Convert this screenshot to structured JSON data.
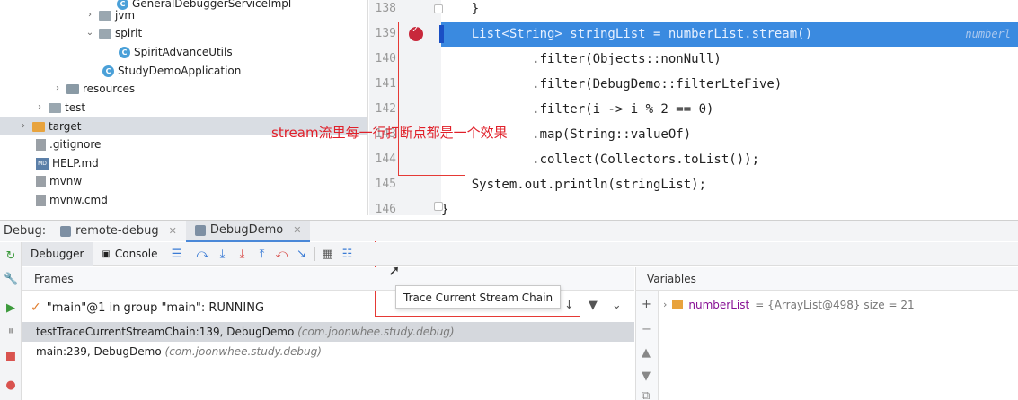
{
  "tree": {
    "items": [
      {
        "label": "GeneralDebuggerServiceImpl",
        "icon": "class-icon"
      },
      {
        "label": "jvm",
        "icon": "folder-icon"
      },
      {
        "label": "spirit",
        "icon": "folder-icon"
      },
      {
        "label": "SpiritAdvanceUtils",
        "icon": "class-icon"
      },
      {
        "label": "StudyDemoApplication",
        "icon": "class-icon"
      },
      {
        "label": "resources",
        "icon": "folder-icon"
      },
      {
        "label": "test",
        "icon": "folder-icon"
      },
      {
        "label": "target",
        "icon": "folder-icon"
      },
      {
        "label": ".gitignore",
        "icon": "file-icon"
      },
      {
        "label": "HELP.md",
        "icon": "markdown-icon"
      },
      {
        "label": "mvnw",
        "icon": "file-icon"
      },
      {
        "label": "mvnw.cmd",
        "icon": "file-icon"
      }
    ]
  },
  "editor": {
    "lines": [
      {
        "num": "138",
        "text": "    }"
      },
      {
        "num": "139",
        "text": "    List<String> stringList = numberList.stream()",
        "hint": "numberl"
      },
      {
        "num": "140",
        "text": "            .filter(Objects::nonNull)"
      },
      {
        "num": "141",
        "text": "            .filter(DebugDemo::filterLteFive)"
      },
      {
        "num": "142",
        "text": "            .filter(i -> i % 2 == 0)"
      },
      {
        "num": "143",
        "text": "            .map(String::valueOf)"
      },
      {
        "num": "144",
        "text": "            .collect(Collectors.toList());"
      },
      {
        "num": "145",
        "text": "    System.out.println(stringList);"
      },
      {
        "num": "146",
        "text": "}"
      }
    ]
  },
  "annotation": "stream流里每一行打断点都是一个效果",
  "debug": {
    "label": "Debug:",
    "tabs": [
      "remote-debug",
      "DebugDemo"
    ],
    "toolbar_tabs": [
      "Debugger",
      "Console"
    ],
    "frames_header": "Frames",
    "variables_header": "Variables",
    "thread": "\"main\"@1 in group \"main\": RUNNING",
    "frames": [
      {
        "method": "testTraceCurrentStreamChain:139, DebugDemo",
        "pkg": "(com.joonwhee.study.debug)"
      },
      {
        "method": "main:239, DebugDemo",
        "pkg": "(com.joonwhee.study.debug)"
      }
    ],
    "variable": {
      "name": "numberList",
      "value": "= {ArrayList@498}  size = 21"
    },
    "tooltip": "Trace Current Stream Chain"
  },
  "colors": {
    "highlight": "#3a8ae0",
    "annotation": "#e0202a",
    "breakpoint": "#c8283b"
  }
}
